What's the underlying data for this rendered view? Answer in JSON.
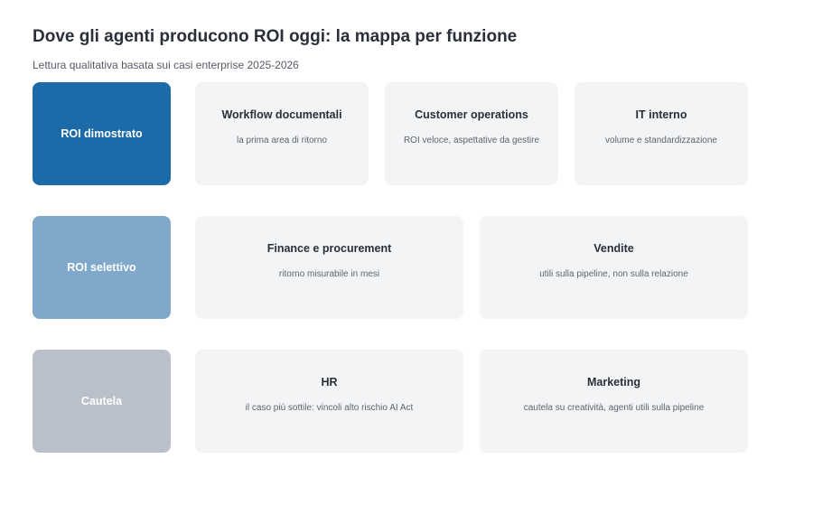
{
  "header": {
    "title": "Dove gli agenti producono ROI oggi: la mappa per funzione",
    "subtitle": "Lettura qualitativa basata sui casi enterprise 2025-2026"
  },
  "rows": [
    {
      "label": "ROI dimostrato",
      "color": "#1d6aa8",
      "cards": [
        {
          "title": "Workflow documentali",
          "desc": "la prima area di ritorno"
        },
        {
          "title": "Customer operations",
          "desc": "ROI veloce, aspettative da gestire"
        },
        {
          "title": "IT interno",
          "desc": "volume e standardizzazione"
        }
      ]
    },
    {
      "label": "ROI selettivo",
      "color": "#7fa8cb",
      "cards": [
        {
          "title": "Finance e procurement",
          "desc": "ritorno misurabile in mesi"
        },
        {
          "title": "Vendite",
          "desc": "utili sulla pipeline, non sulla relazione"
        }
      ]
    },
    {
      "label": "Cautela",
      "color": "#b9c0c9",
      "cards": [
        {
          "title": "HR",
          "desc": "il caso più sottile: vincoli alto rischio AI Act"
        },
        {
          "title": "Marketing",
          "desc": "cautela su creatività, agenti utili sulla pipeline"
        }
      ]
    }
  ]
}
